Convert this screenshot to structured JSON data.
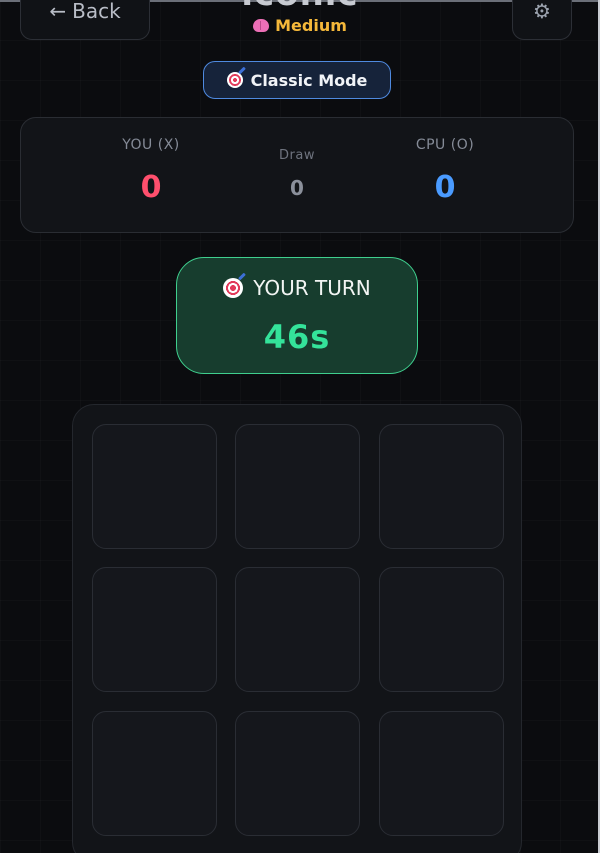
{
  "header": {
    "back_label": "Back",
    "back_arrow": "←",
    "title": "iconic",
    "difficulty": "Medium",
    "settings_icon": "⚙"
  },
  "mode": {
    "label": "Classic Mode"
  },
  "score": {
    "you_label": "YOU (X)",
    "you_value": "0",
    "draw_label": "Draw",
    "draw_value": "0",
    "cpu_label": "CPU (O)",
    "cpu_value": "0"
  },
  "turn": {
    "label": "YOUR TURN",
    "timer": "46s"
  },
  "board": {
    "cells": [
      "",
      "",
      "",
      "",
      "",
      "",
      "",
      "",
      ""
    ]
  },
  "colors": {
    "player_x": "#ff4f6d",
    "player_o": "#4a9bff",
    "difficulty": "#f5b83a",
    "turn_bg": "#173d2e",
    "turn_accent": "#34e39a",
    "mode_border": "#4f8ae0"
  }
}
